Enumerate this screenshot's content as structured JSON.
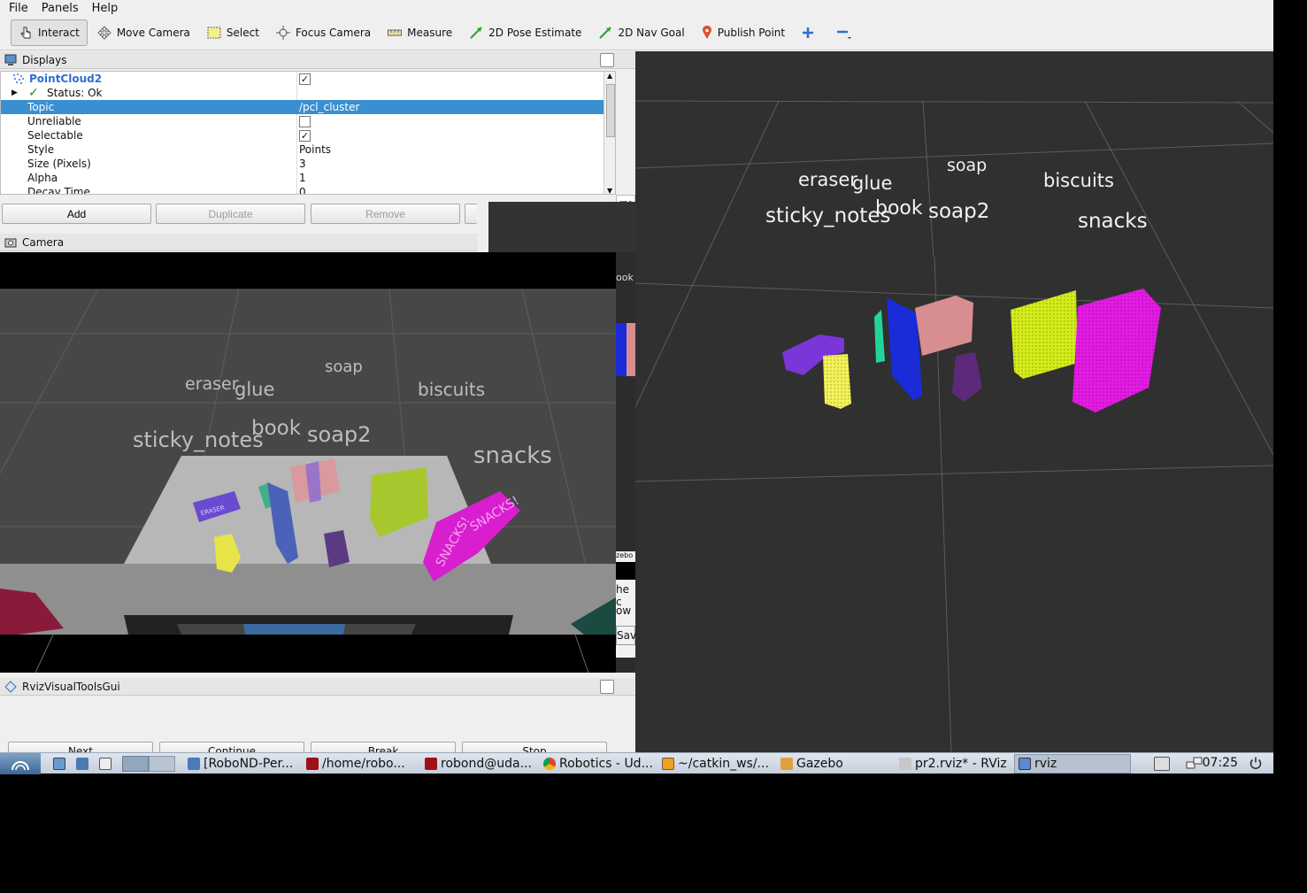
{
  "menu": {
    "file": "File",
    "panels": "Panels",
    "help": "Help"
  },
  "toolbar": {
    "interact": "Interact",
    "move_camera": "Move Camera",
    "select": "Select",
    "focus_camera": "Focus Camera",
    "measure": "Measure",
    "pose_estimate": "2D Pose Estimate",
    "nav_goal": "2D Nav Goal",
    "publish_point": "Publish Point"
  },
  "displays": {
    "title": "Displays",
    "item_name": "PointCloud2",
    "status": "Status: Ok",
    "properties": [
      {
        "key": "Topic",
        "value": "/pcl_cluster",
        "selected": true,
        "checkbox": false
      },
      {
        "key": "Unreliable",
        "value": "",
        "checkbox": true,
        "checked": false
      },
      {
        "key": "Selectable",
        "value": "",
        "checkbox": true,
        "checked": true
      },
      {
        "key": "Style",
        "value": "Points"
      },
      {
        "key": "Size (Pixels)",
        "value": "3"
      },
      {
        "key": "Alpha",
        "value": "1"
      },
      {
        "key": "Decay Time",
        "value": "0"
      }
    ],
    "add": "Add",
    "duplicate": "Duplicate",
    "remove": "Remove"
  },
  "camera": {
    "title": "Camera"
  },
  "scene_labels": {
    "eraser": "eraser",
    "glue": "glue",
    "soap": "soap",
    "biscuits": "biscuits",
    "sticky_notes": "sticky_notes",
    "book": "book",
    "soap2": "soap2",
    "snacks": "snacks"
  },
  "camera_labels": {
    "eraser": "eraser",
    "glue": "glue",
    "soap": "soap",
    "biscuits": "biscuits",
    "sticky_notes": "sticky_notes",
    "book": "book",
    "soap2": "soap2",
    "snacks": "snacks",
    "eraser_print": "ERASER",
    "snacks_print_1": "SNACKS!",
    "snacks_print_2": "SNACKS!"
  },
  "fragments": {
    "rv": "rv",
    "ook": "ook",
    "zebo": "zebo",
    "he": "he c",
    "ow": "ow",
    "sav": "Sav"
  },
  "tools_panel": {
    "title": "RvizVisualToolsGui",
    "next": "Next",
    "continue": "Continue",
    "break": "Break",
    "stop": "Stop"
  },
  "taskbar": {
    "tasks": [
      "[RoboND-Per...",
      "/home/robo...",
      "robond@uda...",
      "Robotics - Ud...",
      "~/catkin_ws/...",
      "Gazebo",
      "pr2.rviz* - RViz",
      "rviz"
    ],
    "clock": "07:25"
  },
  "colors": {
    "accent_selection": "#3a8fd0",
    "viewport_bg": "#303030",
    "grid": "#5a5a5a",
    "cloud_magenta": "#e41be4",
    "cloud_lime": "#d4ec1a",
    "cloud_pink": "#d88e90",
    "cloud_blue": "#1a2bd8",
    "cloud_purple": "#7a36d8",
    "cloud_yellow": "#f2f25a",
    "cloud_teal": "#22d49c",
    "cloud_plum": "#5c2a78"
  }
}
